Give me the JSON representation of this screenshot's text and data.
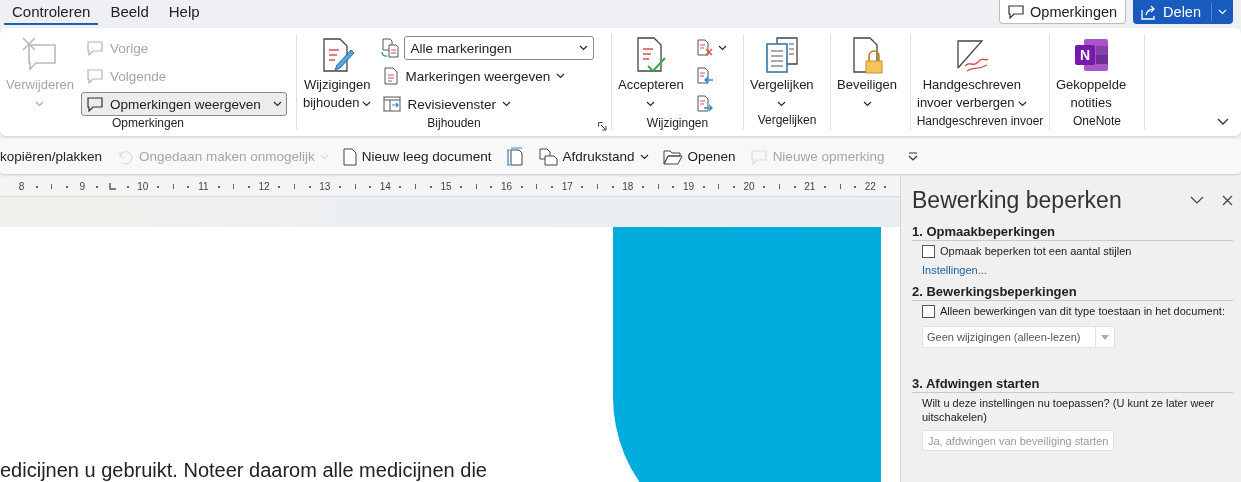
{
  "tabs": [
    {
      "label": "Controleren",
      "selected": true
    },
    {
      "label": "Beeld",
      "selected": false
    },
    {
      "label": "Help",
      "selected": false
    }
  ],
  "header_buttons": [
    {
      "kind": "outline",
      "label": "Opmerkingen",
      "caret": false
    },
    {
      "kind": "primary",
      "label": "Delen",
      "caret": true
    }
  ],
  "ribbon": {
    "groups": [
      {
        "label": "Opmerkingen",
        "launcher": false,
        "items": [
          {
            "kind": "large",
            "label": "Verwijderen",
            "disabled": true,
            "pressed": false,
            "caret": true
          },
          {
            "kind": "small",
            "label": "Vorige",
            "disabled": true,
            "pressed": false,
            "caret": false
          },
          {
            "kind": "small",
            "label": "Volgende",
            "disabled": true,
            "pressed": false,
            "caret": false
          },
          {
            "kind": "small",
            "label": "Opmerkingen weergeven",
            "disabled": false,
            "pressed": true,
            "caret": true
          }
        ]
      },
      {
        "label": "Bijhouden",
        "launcher": true,
        "items": [
          {
            "kind": "large",
            "label": "Wijzigingen\nbijhouden",
            "disabled": false,
            "pressed": false,
            "caret": true
          },
          {
            "kind": "select",
            "label": "Alle markeringen",
            "disabled": false,
            "pressed": false,
            "caret": true
          },
          {
            "kind": "small",
            "label": "Markeringen weergeven",
            "disabled": false,
            "pressed": false,
            "caret": true
          },
          {
            "kind": "small",
            "label": "Revisievenster",
            "disabled": false,
            "pressed": false,
            "caret": true
          }
        ]
      },
      {
        "label": "Wijzigingen",
        "launcher": false,
        "items": [
          {
            "kind": "large",
            "label": "Accepteren",
            "disabled": false,
            "pressed": false,
            "caret": true
          },
          {
            "kind": "icon",
            "disabled": false,
            "pressed": false,
            "caret": true
          },
          {
            "kind": "icon",
            "disabled": false,
            "pressed": false,
            "caret": false
          },
          {
            "kind": "icon",
            "disabled": false,
            "pressed": false,
            "caret": false
          }
        ]
      },
      {
        "label": "Vergelijken",
        "launcher": false,
        "items": [
          {
            "kind": "large",
            "label": "Vergelijken",
            "disabled": false,
            "pressed": false,
            "caret": true
          }
        ]
      },
      {
        "launcher": false,
        "items": [
          {
            "kind": "large",
            "label": "Beveiligen",
            "disabled": false,
            "pressed": false,
            "caret": true
          }
        ]
      },
      {
        "label": "Handgeschreven invoer",
        "launcher": false,
        "items": [
          {
            "kind": "large",
            "label": "Handgeschreven\ninvoer verbergen",
            "disabled": false,
            "pressed": false,
            "caret": true
          }
        ]
      },
      {
        "label": "OneNote",
        "launcher": false,
        "items": [
          {
            "kind": "large",
            "label": "Gekoppelde\nnotities",
            "disabled": false,
            "pressed": false,
            "caret": false,
            "logo_letter": "N"
          }
        ]
      }
    ]
  },
  "quick_access": [
    {
      "kind": "button",
      "label": "kopiëren/plakken",
      "disabled": false,
      "caret": false
    },
    {
      "kind": "button",
      "label": "Ongedaan maken onmogelijk",
      "disabled": true,
      "caret": true
    },
    {
      "kind": "button",
      "label": "Nieuw leeg document",
      "disabled": false,
      "caret": false
    },
    {
      "kind": "icon",
      "disabled": false,
      "caret": false
    },
    {
      "kind": "button",
      "label": "Afdrukstand",
      "disabled": false,
      "caret": true
    },
    {
      "kind": "button",
      "label": "Openen",
      "disabled": false,
      "caret": false
    },
    {
      "kind": "button",
      "label": "Nieuwe opmerking",
      "disabled": true,
      "caret": false
    }
  ],
  "ruler": {
    "labels": [
      "8",
      "9",
      "10",
      "11",
      "12",
      "13",
      "14",
      "15",
      "16",
      "17",
      "18",
      "19",
      "20",
      "21",
      "22"
    ]
  },
  "document": {
    "text": "edicijnen u gebruikt. Noteer daarom alle medicijnen die"
  },
  "task_pane": {
    "title": "Bewerking beperken",
    "sections": [
      {
        "heading": "1. Opmaakbeperkingen",
        "checkbox": {
          "label": "Opmaak beperken tot een aantal stijlen",
          "checked": false
        },
        "link": "Instellingen..."
      },
      {
        "heading": "2. Bewerkingsbeperkingen",
        "checkbox": {
          "label": "Alleen bewerkingen van dit type toestaan in het document:",
          "checked": false
        },
        "select": {
          "value": "Geen wijzigingen (alleen-lezen)",
          "disabled": true
        }
      },
      {
        "heading": "3. Afdwingen starten",
        "description": "Wilt u deze instellingen nu toepassen? (U kunt ze later weer uitschakelen)",
        "button": {
          "label": "Ja, afdwingen van beveiliging starten",
          "disabled": true
        }
      }
    ]
  }
}
